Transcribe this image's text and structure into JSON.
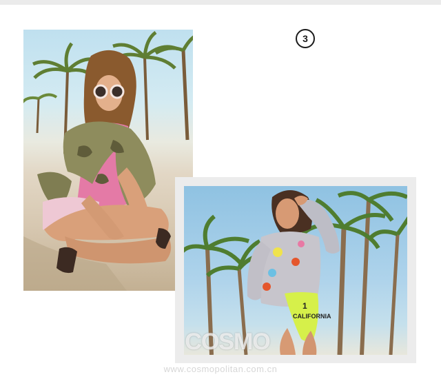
{
  "gallery": {
    "item_number": "3",
    "watermark": {
      "logo": "COSMO",
      "url": "www.cosmopolitan.com.cn"
    },
    "photo_right": {
      "shirt_text": "CALIFORNIA",
      "shirt_number": "1"
    }
  },
  "colors": {
    "page_background": "#ffffff",
    "frame": "#ececec",
    "badge_border": "#1a1a1a"
  }
}
